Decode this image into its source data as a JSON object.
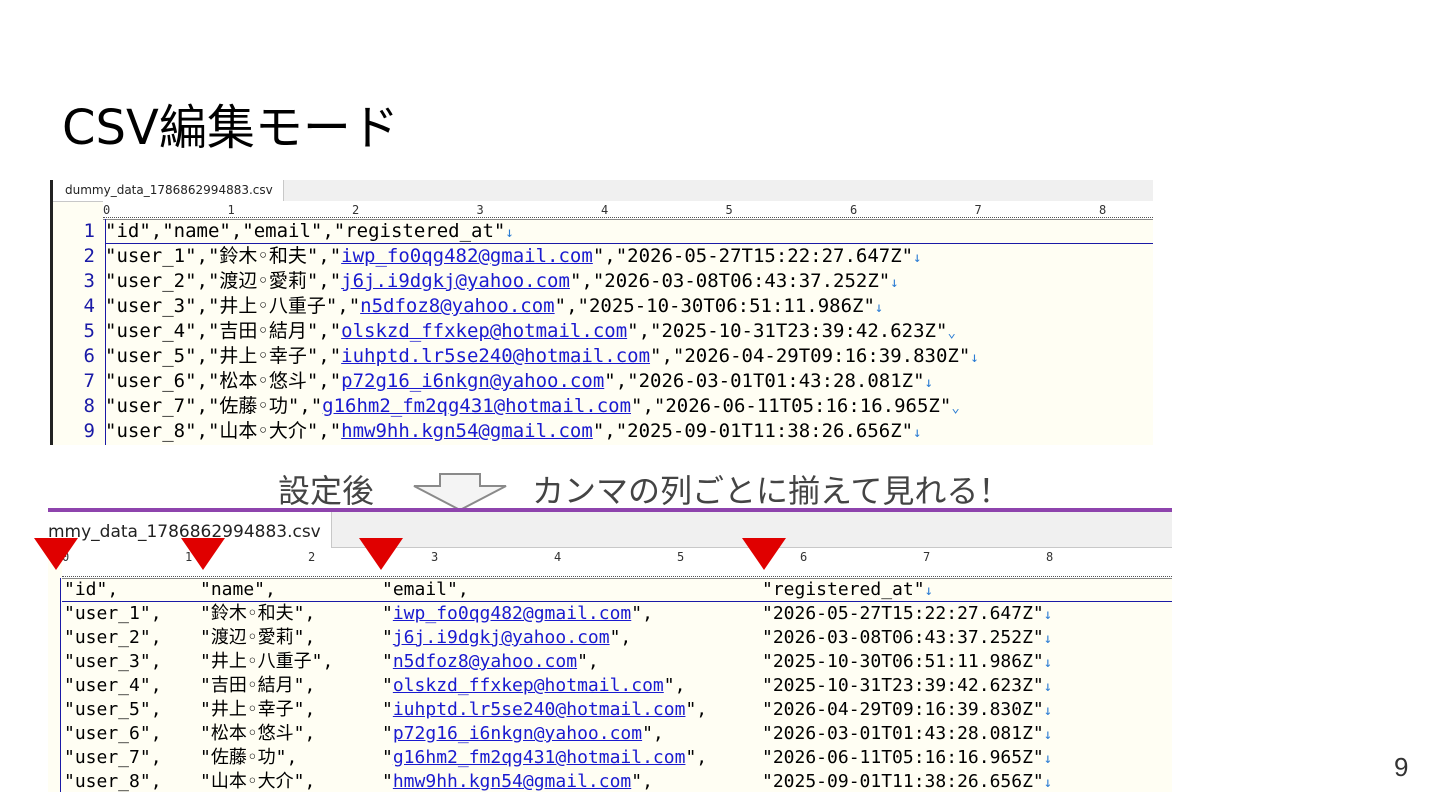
{
  "slide": {
    "title": "CSV編集モード",
    "page_number": "9",
    "caption_left": "設定後",
    "caption_right": "カンマの列ごとに揃えて見れる！"
  },
  "before": {
    "tab_label": "dummy_data_1786862994883.csv",
    "ruler_marks": [
      "0",
      "1",
      "2",
      "3",
      "4",
      "5",
      "6",
      "7",
      "8"
    ],
    "line_numbers": [
      "1",
      "2",
      "3",
      "4",
      "5",
      "6",
      "7",
      "8",
      "9"
    ],
    "lines": [
      {
        "pre": "\"id\",\"name\",\"email\",\"registered_at\"",
        "link": "",
        "post": "",
        "eol": "↓"
      },
      {
        "pre": "\"user_1\",\"鈴木◦和夫\",\"",
        "link": "iwp_fo0qg482@gmail.com",
        "post": "\",\"2026-05-27T15:22:27.647Z\"",
        "eol": "↓"
      },
      {
        "pre": "\"user_2\",\"渡辺◦愛莉\",\"",
        "link": "j6j.i9dgkj@yahoo.com",
        "post": "\",\"2026-03-08T06:43:37.252Z\"",
        "eol": "↓"
      },
      {
        "pre": "\"user_3\",\"井上◦八重子\",\"",
        "link": "n5dfoz8@yahoo.com",
        "post": "\",\"2025-10-30T06:51:11.986Z\"",
        "eol": "↓"
      },
      {
        "pre": "\"user_4\",\"吉田◦結月\",\"",
        "link": "olskzd_ffxkep@hotmail.com",
        "post": "\",\"2025-10-31T23:39:42.623Z\"",
        "eol": "⌄"
      },
      {
        "pre": "\"user_5\",\"井上◦幸子\",\"",
        "link": "iuhptd.lr5se240@hotmail.com",
        "post": "\",\"2026-04-29T09:16:39.830Z\"",
        "eol": "↓"
      },
      {
        "pre": "\"user_6\",\"松本◦悠斗\",\"",
        "link": "p72g16_i6nkgn@yahoo.com",
        "post": "\",\"2026-03-01T01:43:28.081Z\"",
        "eol": "↓"
      },
      {
        "pre": "\"user_7\",\"佐藤◦功\",\"",
        "link": "g16hm2_fm2qg431@hotmail.com",
        "post": "\",\"2026-06-11T05:16:16.965Z\"",
        "eol": "⌄"
      },
      {
        "pre": "\"user_8\",\"山本◦大介\",\"",
        "link": "hmw9hh.kgn54@gmail.com",
        "post": "\",\"2025-09-01T11:38:26.656Z\"",
        "eol": "↓"
      }
    ]
  },
  "after": {
    "tab_label": "mmy_data_1786862994883.csv",
    "ruler_marks": [
      "0",
      "1",
      "2",
      "3",
      "4",
      "5",
      "6",
      "7",
      "8"
    ],
    "header": {
      "c0": "\"id\",",
      "c1": "\"name\",",
      "c2": "\"email\",",
      "c3": "\"registered_at\"",
      "eol": "↓"
    },
    "rows": [
      {
        "c0": "\"user_1\",",
        "c1": "\"鈴木◦和夫\",",
        "c2q": "\"",
        "c2": "iwp_fo0qg482@gmail.com",
        "c2e": "\",",
        "c3": "\"2026-05-27T15:22:27.647Z\"",
        "eol": "↓"
      },
      {
        "c0": "\"user_2\",",
        "c1": "\"渡辺◦愛莉\",",
        "c2q": "\"",
        "c2": "j6j.i9dgkj@yahoo.com",
        "c2e": "\",",
        "c3": "\"2026-03-08T06:43:37.252Z\"",
        "eol": "↓"
      },
      {
        "c0": "\"user_3\",",
        "c1": "\"井上◦八重子\",",
        "c2q": "\"",
        "c2": "n5dfoz8@yahoo.com",
        "c2e": "\",",
        "c3": "\"2025-10-30T06:51:11.986Z\"",
        "eol": "↓"
      },
      {
        "c0": "\"user_4\",",
        "c1": "\"吉田◦結月\",",
        "c2q": "\"",
        "c2": "olskzd_ffxkep@hotmail.com",
        "c2e": "\",",
        "c3": "\"2025-10-31T23:39:42.623Z\"",
        "eol": "↓"
      },
      {
        "c0": "\"user_5\",",
        "c1": "\"井上◦幸子\",",
        "c2q": "\"",
        "c2": "iuhptd.lr5se240@hotmail.com",
        "c2e": "\",",
        "c3": "\"2026-04-29T09:16:39.830Z\"",
        "eol": "↓"
      },
      {
        "c0": "\"user_6\",",
        "c1": "\"松本◦悠斗\",",
        "c2q": "\"",
        "c2": "p72g16_i6nkgn@yahoo.com",
        "c2e": "\",",
        "c3": "\"2026-03-01T01:43:28.081Z\"",
        "eol": "↓"
      },
      {
        "c0": "\"user_7\",",
        "c1": "\"佐藤◦功\",",
        "c2q": "\"",
        "c2": "g16hm2_fm2qg431@hotmail.com",
        "c2e": "\",",
        "c3": "\"2026-06-11T05:16:16.965Z\"",
        "eol": "↓"
      },
      {
        "c0": "\"user_8\",",
        "c1": "\"山本◦大介\",",
        "c2q": "\"",
        "c2": "hmw9hh.kgn54@gmail.com",
        "c2e": "\",",
        "c3": "\"2025-09-01T11:38:26.656Z\"",
        "eol": "↓"
      }
    ]
  },
  "colors": {
    "marker": "#e00000",
    "link": "#1a1ad0",
    "line_number": "#1a1aa6",
    "editor_bg": "#fffef3",
    "tab_accent": "#8e44ad"
  }
}
